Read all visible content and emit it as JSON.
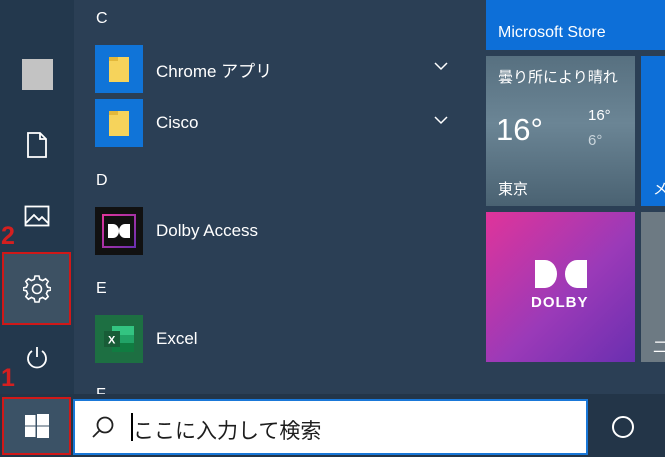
{
  "steps": {
    "one": "1",
    "two": "2"
  },
  "app_list": {
    "letters": {
      "c": "C",
      "d": "D",
      "e": "E",
      "f": "F"
    },
    "apps": [
      {
        "label": "Chrome アプリ",
        "icon": "folder-icon",
        "expandable": true
      },
      {
        "label": "Cisco",
        "icon": "folder-icon",
        "expandable": true
      },
      {
        "label": "Dolby Access",
        "icon": "dolby-icon",
        "expandable": false
      },
      {
        "label": "Excel",
        "icon": "excel-icon",
        "expandable": false
      }
    ]
  },
  "tiles": {
    "store": {
      "label": "Microsoft Store"
    },
    "weather": {
      "condition": "曇り所により晴れ",
      "temp": "16°",
      "high": "16°",
      "low": "6°",
      "city": "東京"
    },
    "edge_partial": {
      "label": "メ"
    },
    "dolby": {
      "label": "DOLBY"
    },
    "edge2_partial": {
      "label": "二"
    }
  },
  "taskbar": {
    "search_placeholder": "ここに入力して検索"
  },
  "colors": {
    "accent": "#0d6fd8",
    "highlight": "#d01818",
    "folder": "#f6d35b",
    "excel": "#1d6f42"
  }
}
